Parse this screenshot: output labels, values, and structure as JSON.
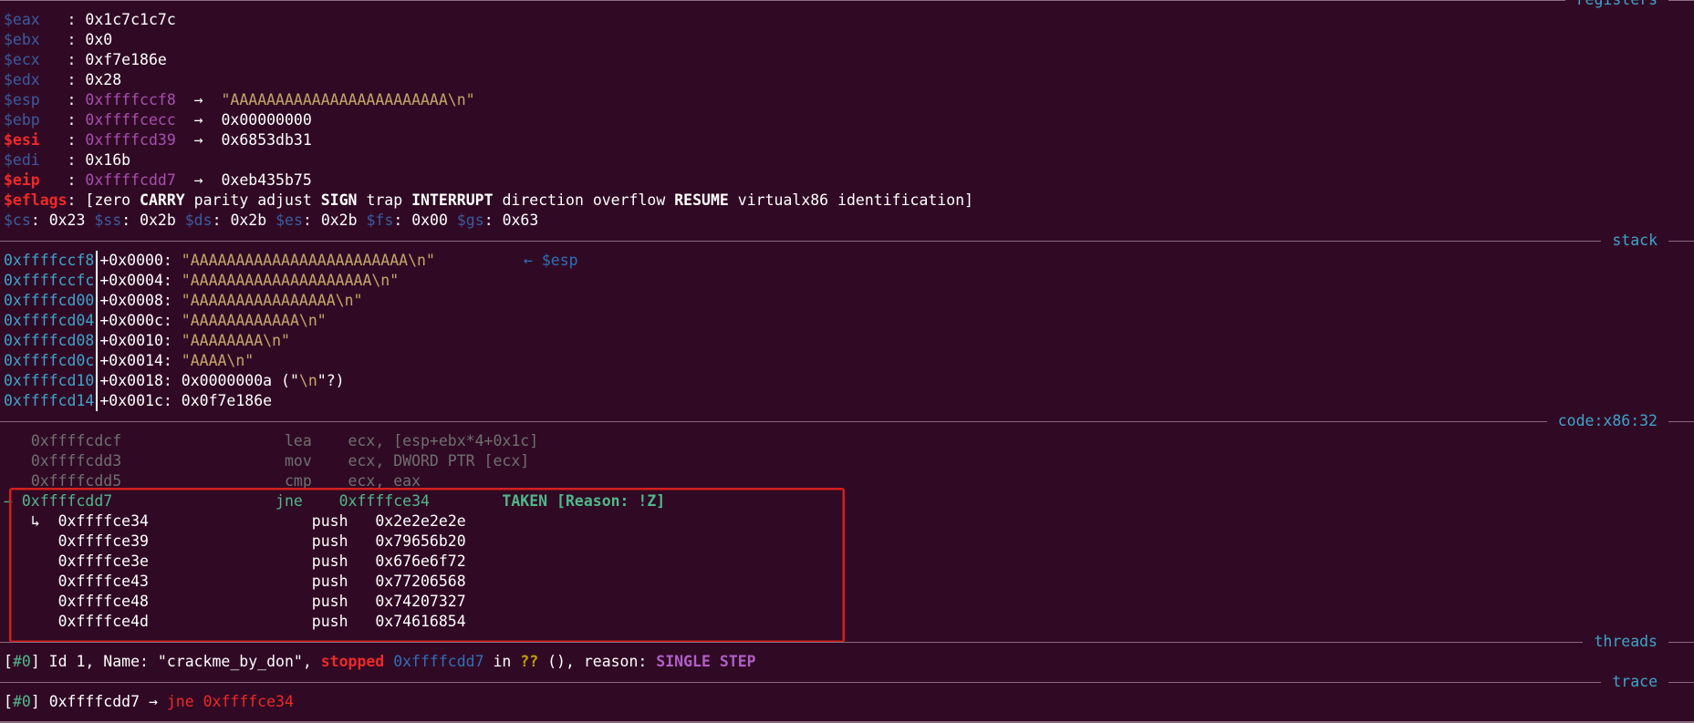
{
  "sections": {
    "registers": "registers",
    "stack": "stack",
    "code": "code:x86:32",
    "threads": "threads",
    "trace": "trace"
  },
  "registers": [
    {
      "name": "$eax",
      "value": "0x1c7c1c7c"
    },
    {
      "name": "$ebx",
      "value": "0x0"
    },
    {
      "name": "$ecx",
      "value": "0xf7e186e"
    },
    {
      "name": "$edx",
      "value": "0x28"
    },
    {
      "name": "$esp",
      "value": "0xffffccf8",
      "arrow": "→",
      "target": "\"AAAAAAAAAAAAAAAAAAAAAAAA\\n\""
    },
    {
      "name": "$ebp",
      "value": "0xffffcecc",
      "arrow": "→",
      "target": "0x00000000"
    },
    {
      "name": "$esi",
      "value": "0xffffcd39",
      "arrow": "→",
      "target": "0x6853db31"
    },
    {
      "name": "$edi",
      "value": "0x16b"
    },
    {
      "name": "$eip",
      "value": "0xffffcdd7",
      "arrow": "→",
      "target": "0xeb435b75"
    }
  ],
  "eflags": {
    "name": "$eflags",
    "flags": [
      "zero",
      "CARRY",
      "parity",
      "adjust",
      "SIGN",
      "trap",
      "INTERRUPT",
      "direction",
      "overflow",
      "RESUME",
      "virtualx86",
      "identification"
    ]
  },
  "segments": [
    {
      "name": "$cs",
      "value": "0x23"
    },
    {
      "name": "$ss",
      "value": "0x2b"
    },
    {
      "name": "$ds",
      "value": "0x2b"
    },
    {
      "name": "$es",
      "value": "0x2b"
    },
    {
      "name": "$fs",
      "value": "0x00"
    },
    {
      "name": "$gs",
      "value": "0x63"
    }
  ],
  "stack": [
    {
      "addr": "0xffffccf8",
      "offset": "+0x0000:",
      "value": "\"AAAAAAAAAAAAAAAAAAAAAAAA\\n\"",
      "tag": "← $esp"
    },
    {
      "addr": "0xffffccfc",
      "offset": "+0x0004:",
      "value": "\"AAAAAAAAAAAAAAAAAAAA\\n\""
    },
    {
      "addr": "0xffffcd00",
      "offset": "+0x0008:",
      "value": "\"AAAAAAAAAAAAAAAA\\n\""
    },
    {
      "addr": "0xffffcd04",
      "offset": "+0x000c:",
      "value": "\"AAAAAAAAAAAA\\n\""
    },
    {
      "addr": "0xffffcd08",
      "offset": "+0x0010:",
      "value": "\"AAAAAAAA\\n\""
    },
    {
      "addr": "0xffffcd0c",
      "offset": "+0x0014:",
      "value": "\"AAAA\\n\""
    },
    {
      "addr": "0xffffcd10",
      "offset": "+0x0018:",
      "value": "0x0000000a",
      "extra_pre": " (\"",
      "extra_str": "\\n",
      "extra_post": "\"?)"
    },
    {
      "addr": "0xffffcd14",
      "offset": "+0x001c:",
      "value": "0x0f7e186e"
    }
  ],
  "code_past": [
    {
      "addr": "0xffffcdcf",
      "mnem": "lea",
      "ops": "ecx, [esp+ebx*4+0x1c]"
    },
    {
      "addr": "0xffffcdd3",
      "mnem": "mov",
      "ops": "ecx, DWORD PTR [ecx]"
    },
    {
      "addr": "0xffffcdd5",
      "mnem": "cmp",
      "ops": "ecx, eax"
    }
  ],
  "code_current": {
    "marker": "→",
    "addr": "0xffffcdd7",
    "mnem": "jne",
    "ops": "0xffffce34",
    "note": "TAKEN [Reason: !Z]"
  },
  "code_branch": [
    {
      "marker": "↳",
      "addr": "0xffffce34",
      "mnem": "push",
      "ops": "0x2e2e2e2e"
    },
    {
      "addr": "0xffffce39",
      "mnem": "push",
      "ops": "0x79656b20"
    },
    {
      "addr": "0xffffce3e",
      "mnem": "push",
      "ops": "0x676e6f72"
    },
    {
      "addr": "0xffffce43",
      "mnem": "push",
      "ops": "0x77206568"
    },
    {
      "addr": "0xffffce48",
      "mnem": "push",
      "ops": "0x74207327"
    },
    {
      "addr": "0xffffce4d",
      "mnem": "push",
      "ops": "0x74616854"
    }
  ],
  "thread": {
    "id_tag": "#0",
    "text1": " Id 1, Name: \"crackme_by_don\", ",
    "state": "stopped",
    "addr": "0xffffcdd7",
    "in_text": " in ",
    "func": "??",
    "text2": " (), reason: ",
    "reason": "SINGLE STEP"
  },
  "trace": {
    "id_tag": "#0",
    "addr": "0xffffcdd7",
    "arrow": "→",
    "instr": "jne 0xffffce34"
  }
}
